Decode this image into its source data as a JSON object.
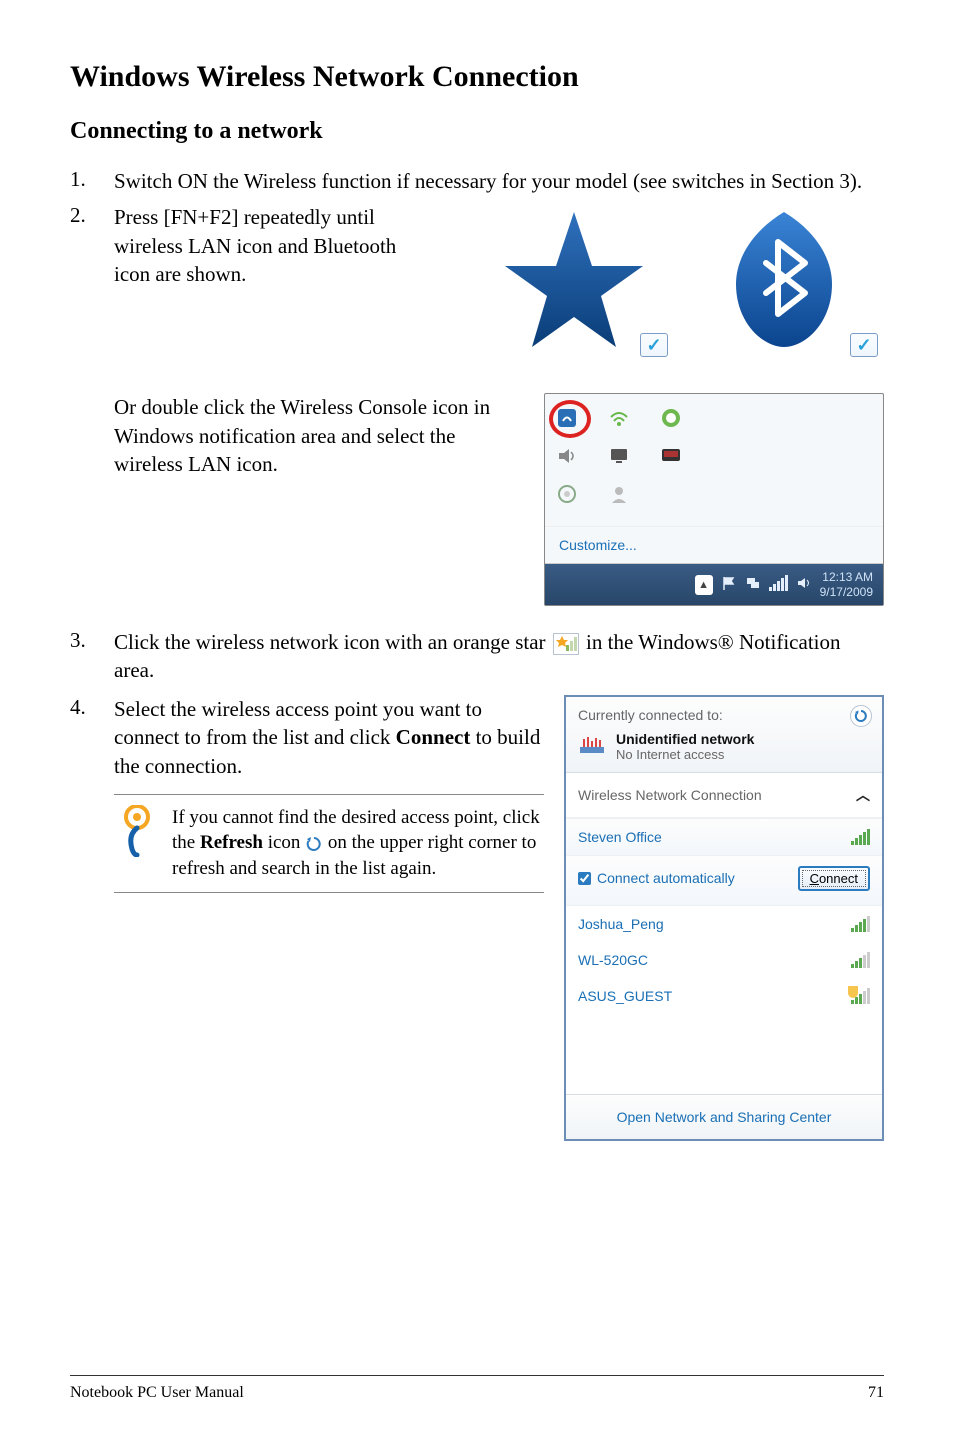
{
  "title": "Windows Wireless Network Connection",
  "subtitle": "Connecting to a network",
  "steps": {
    "s1": {
      "num": "1.",
      "text": "Switch ON the Wireless function if necessary for your model (see switches in Section 3)."
    },
    "s2": {
      "num": "2.",
      "text": "Press [FN+F2] repeatedly until wireless LAN icon and Bluetooth icon are shown."
    },
    "s2b": {
      "text": "Or double click the Wireless Console icon in Windows notification area and select the wireless LAN icon."
    },
    "s3": {
      "num": "3.",
      "pre": "Click the wireless network icon with an orange star",
      "post": "in the Windows® Notification area."
    },
    "s4": {
      "num": "4.",
      "pre": "Select the wireless access point you want to connect to from the list and click ",
      "bold": "Connect",
      "post": " to build the connection."
    }
  },
  "tip": {
    "pre": "If you cannot find the desired access point, click the ",
    "bold": "Refresh",
    "mid": " icon",
    "post": " on the upper right corner to refresh and search in the list again."
  },
  "checkmark": "✓",
  "tray": {
    "customize": "Customize...",
    "arrow_tip": "▲",
    "time_line1": "12:13 AM",
    "time_line2": "9/17/2009"
  },
  "wifi": {
    "connected_to": "Currently connected to:",
    "net_name": "Unidentified network",
    "net_sub": "No Internet access",
    "section": "Wireless Network Connection",
    "items": [
      {
        "name": "Steven Office"
      },
      {
        "name": "Joshua_Peng"
      },
      {
        "name": "WL-520GC"
      },
      {
        "name": "ASUS_GUEST"
      }
    ],
    "auto_label": "Connect automatically",
    "connect_btn": "Connect",
    "footer": "Open Network and Sharing Center",
    "connect_key": "C"
  },
  "footer": {
    "left": "Notebook PC User Manual",
    "right": "71"
  }
}
